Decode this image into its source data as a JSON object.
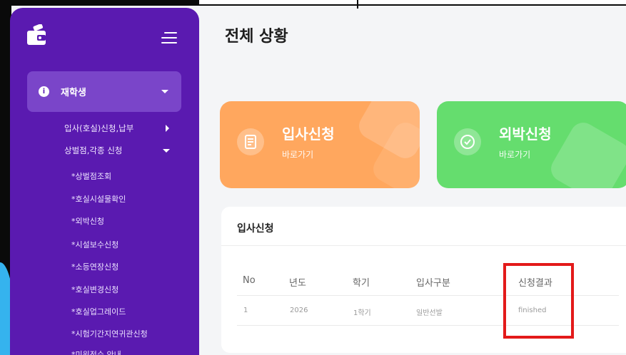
{
  "page_title": "전체 상황",
  "sidebar": {
    "student_menu": {
      "label": "재학생",
      "icon": "info-icon"
    },
    "sub_items": [
      {
        "label": "입사(호실)신청,납부",
        "caret": "right"
      },
      {
        "label": "상벌점,각종 신청",
        "caret": "down"
      }
    ],
    "sub2_items": [
      {
        "label": "*상벌점조회"
      },
      {
        "label": "*호실시설물확인"
      },
      {
        "label": "*외박신청"
      },
      {
        "label": "*시설보수신청"
      },
      {
        "label": "*소등연장신청"
      },
      {
        "label": "*호실변경신청"
      },
      {
        "label": "*호실업그레이드"
      },
      {
        "label": "*시험기간지연귀관신청"
      },
      {
        "label": "*미원전수 안내"
      }
    ]
  },
  "cards": [
    {
      "title": "입사신청",
      "sub": "바로가기",
      "icon": "document-icon",
      "color": "#ffa75e"
    },
    {
      "title": "외박신청",
      "sub": "바로가기",
      "icon": "check-circle-icon",
      "color": "#65dd6e"
    }
  ],
  "panel": {
    "title": "입사신청",
    "columns": [
      "No",
      "년도",
      "학기",
      "입사구분",
      "신청결과"
    ],
    "rows": [
      [
        "1",
        "2026",
        "1학기",
        "일반선발",
        "finished"
      ]
    ]
  },
  "colors": {
    "sidebar": "#5a1ab0",
    "sidebar_active": "#7a45c9",
    "highlight": "#e31a1a"
  }
}
